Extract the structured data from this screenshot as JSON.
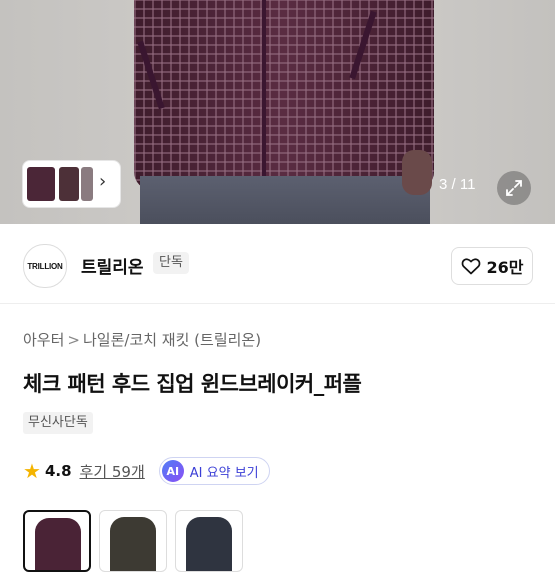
{
  "gallery": {
    "counter": "3 / 11",
    "expand_icon": "expand-icon",
    "thumb_next_icon": "chevron-right-icon"
  },
  "brand": {
    "logo_text": "TRILLION",
    "name": "트릴리온",
    "badge": "단독",
    "like_icon": "heart-outline-icon",
    "like_count": "26만"
  },
  "breadcrumb": {
    "items": [
      "아우터",
      "나일론/코치 재킷 (트릴리온)"
    ],
    "separator": ">"
  },
  "product": {
    "title": "체크 패턴 후드 집업 윈드브레이커_퍼플",
    "tag": "무신사단독"
  },
  "rating": {
    "star_icon": "star-icon",
    "score": "4.8",
    "reviews": "후기 59개",
    "ai_chip": "AI",
    "ai_button": "AI 요약 보기"
  },
  "swatches": {
    "colors": [
      "#4a2336",
      "#3d3a33",
      "#2f3440"
    ],
    "selected_index": 0
  },
  "colors": {
    "star": "#f4b400",
    "ai_accent": "#3b3fd6"
  }
}
